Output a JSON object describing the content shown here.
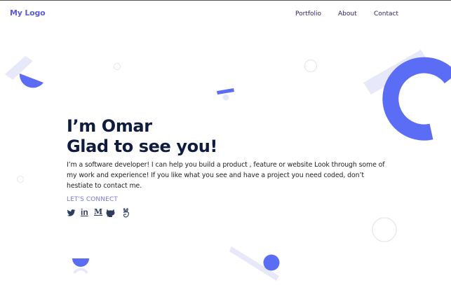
{
  "header": {
    "logo": "My Logo",
    "nav": [
      {
        "label": "Portfolio"
      },
      {
        "label": "About"
      },
      {
        "label": "Contact"
      }
    ]
  },
  "hero": {
    "title_line1": "I’m Omar",
    "title_line2": "Glad to see you!",
    "description": "I’m a software developer! I can help you build a product , feature or website Look through some of my work and experience! If you like what you see and have a project you need coded, don’t hestiate to contact me.",
    "connect_label": "LET'S CONNECT",
    "medium_letter": "M",
    "linkedin_letters": "in",
    "socials": [
      {
        "icon": "twitter-icon"
      },
      {
        "icon": "linkedin-icon"
      },
      {
        "icon": "medium-icon"
      },
      {
        "icon": "github-icon"
      },
      {
        "icon": "angellist-icon"
      }
    ]
  },
  "colors": {
    "brand": "#5b5bd6",
    "accent_blue": "#5b6cf5",
    "light_lavender": "#e8e8fb",
    "heading": "#0f1c3f",
    "nav_text": "#2b1b6b",
    "connect": "#7b7bdc",
    "icon": "#2e3d5c"
  }
}
